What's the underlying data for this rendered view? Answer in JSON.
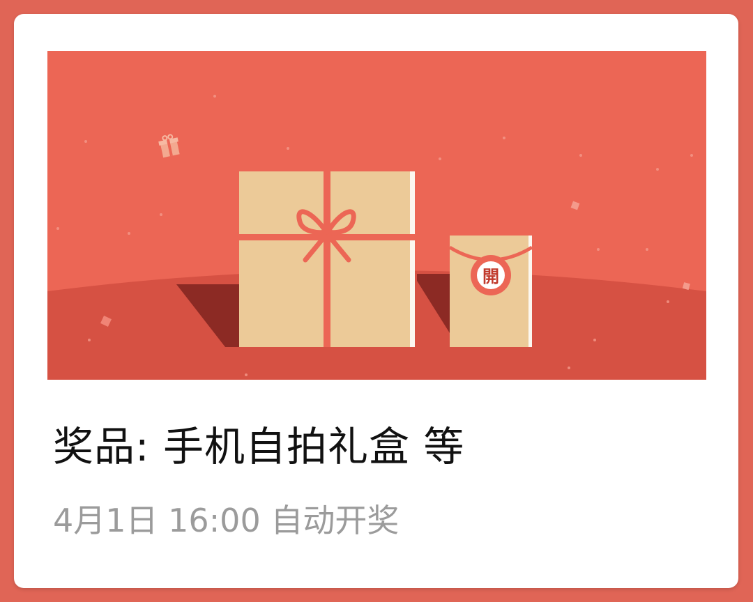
{
  "card": {
    "prize_title": "奖品: 手机自拍礼盒 等",
    "draw_time": "4月1日 16:00 自动开奖"
  },
  "banner": {
    "seal_text": "開",
    "colors": {
      "background": "#ec6655",
      "ground": "#d65143",
      "shadow": "#8c2a24",
      "box": "#ecca98",
      "ribbon": "#ec6655"
    },
    "icons": [
      "small-gift-icon",
      "big-gift-box",
      "envelope-box"
    ]
  }
}
